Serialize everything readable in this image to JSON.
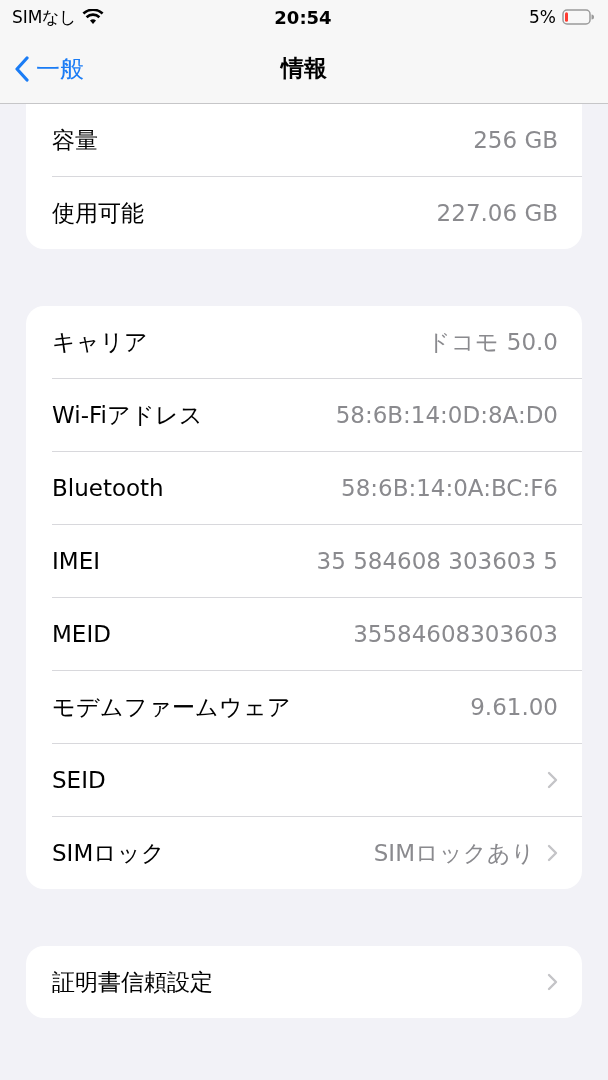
{
  "status_bar": {
    "carrier": "SIMなし",
    "time": "20:54",
    "battery": "5%"
  },
  "nav": {
    "back": "一般",
    "title": "情報"
  },
  "groups": [
    {
      "cut_top": true,
      "rows": [
        {
          "label": "容量",
          "value": "256 GB",
          "chevron": false
        },
        {
          "label": "使用可能",
          "value": "227.06 GB",
          "chevron": false
        }
      ]
    },
    {
      "cut_top": false,
      "rows": [
        {
          "label": "キャリア",
          "value": "ドコモ 50.0",
          "chevron": false
        },
        {
          "label": "Wi-Fiアドレス",
          "value": "58:6B:14:0D:8A:D0",
          "chevron": false
        },
        {
          "label": "Bluetooth",
          "value": "58:6B:14:0A:BC:F6",
          "chevron": false
        },
        {
          "label": "IMEI",
          "value": "35 584608 303603 5",
          "chevron": false
        },
        {
          "label": "MEID",
          "value": "35584608303603",
          "chevron": false
        },
        {
          "label": "モデムファームウェア",
          "value": "9.61.00",
          "chevron": false
        },
        {
          "label": "SEID",
          "chevron": true
        },
        {
          "label": "SIMロック",
          "value": "SIMロックあり",
          "chevron": true
        }
      ]
    },
    {
      "cut_top": false,
      "rows": [
        {
          "label": "証明書信頼設定",
          "chevron": true
        }
      ]
    }
  ]
}
